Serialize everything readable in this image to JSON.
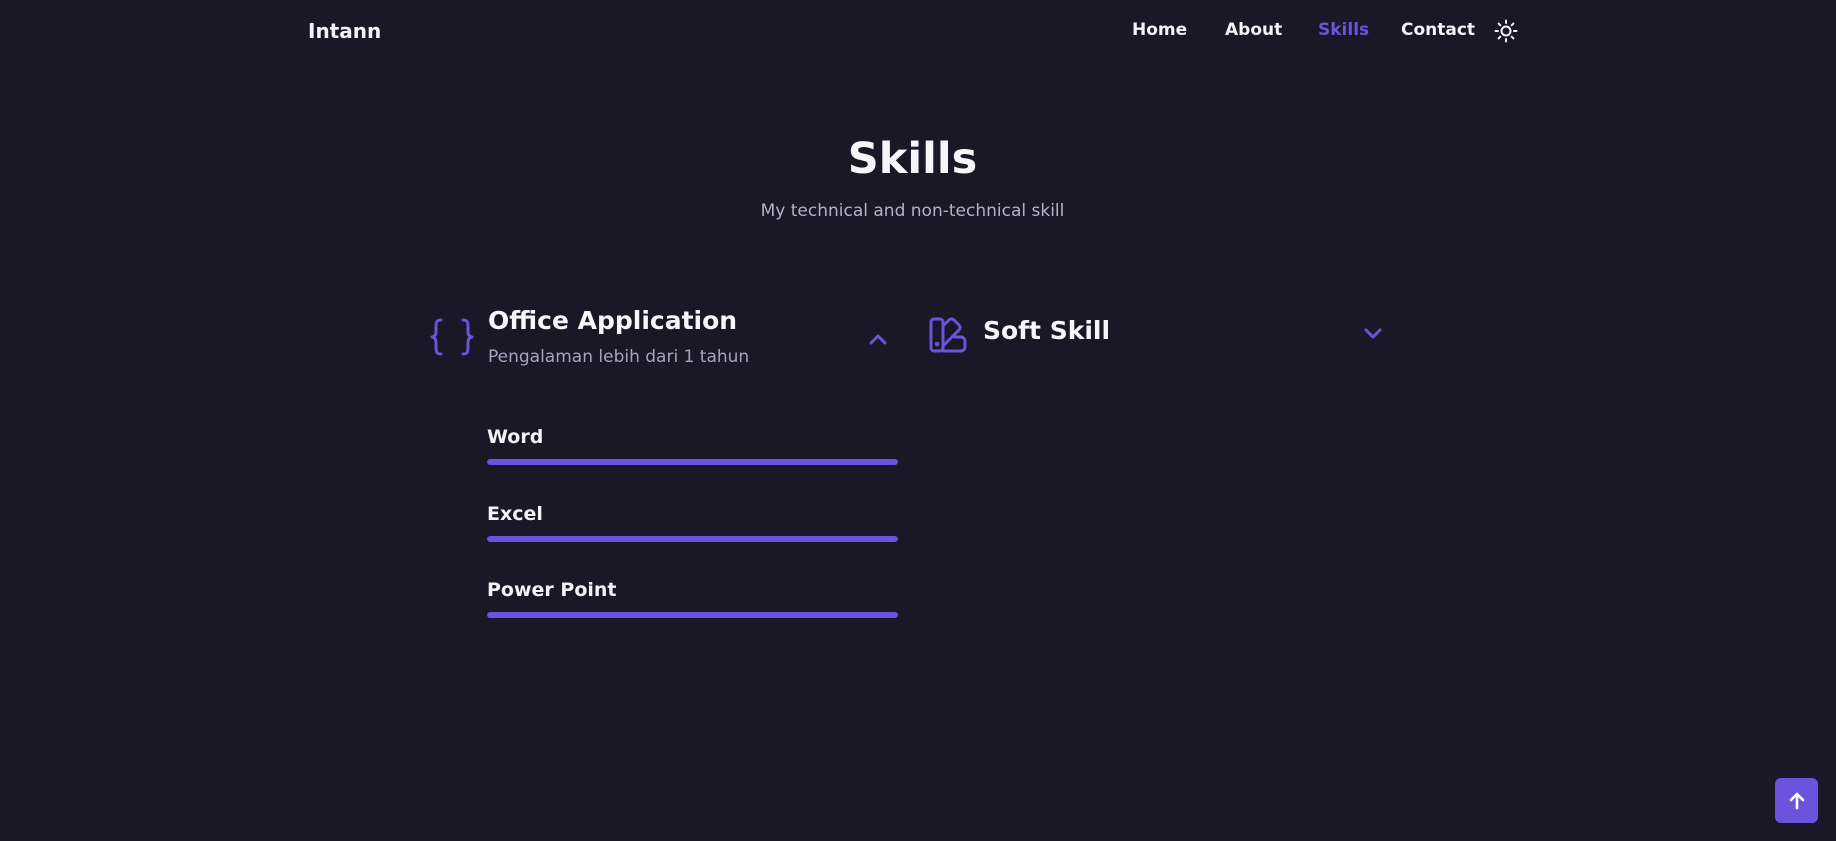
{
  "header": {
    "logo": "Intann",
    "nav": [
      {
        "label": "Home",
        "active": false
      },
      {
        "label": "About",
        "active": false
      },
      {
        "label": "Skills",
        "active": true
      },
      {
        "label": "Contact",
        "active": false
      }
    ],
    "theme_icon": "sun-icon"
  },
  "section": {
    "title": "Skills",
    "subtitle": "My technical and non-technical skill"
  },
  "skill_groups": [
    {
      "title": "Office Application",
      "subtitle": "Pengalaman lebih dari 1 tahun",
      "icon": "code-braces-icon",
      "expanded": true,
      "toggle_icon": "chevron-up-icon",
      "skills": [
        {
          "name": "Word",
          "level_percent": 100
        },
        {
          "name": "Excel",
          "level_percent": 100
        },
        {
          "name": "Power Point",
          "level_percent": 100
        }
      ]
    },
    {
      "title": "Soft Skill",
      "icon": "swatchbook-icon",
      "expanded": false,
      "toggle_icon": "chevron-down-icon"
    }
  ],
  "scroll_up": {
    "icon": "arrow-up-icon"
  },
  "colors": {
    "background": "#1a1727",
    "accent": "#6b53de",
    "text": "#f3f2f7",
    "muted": "#a8a3bd"
  }
}
